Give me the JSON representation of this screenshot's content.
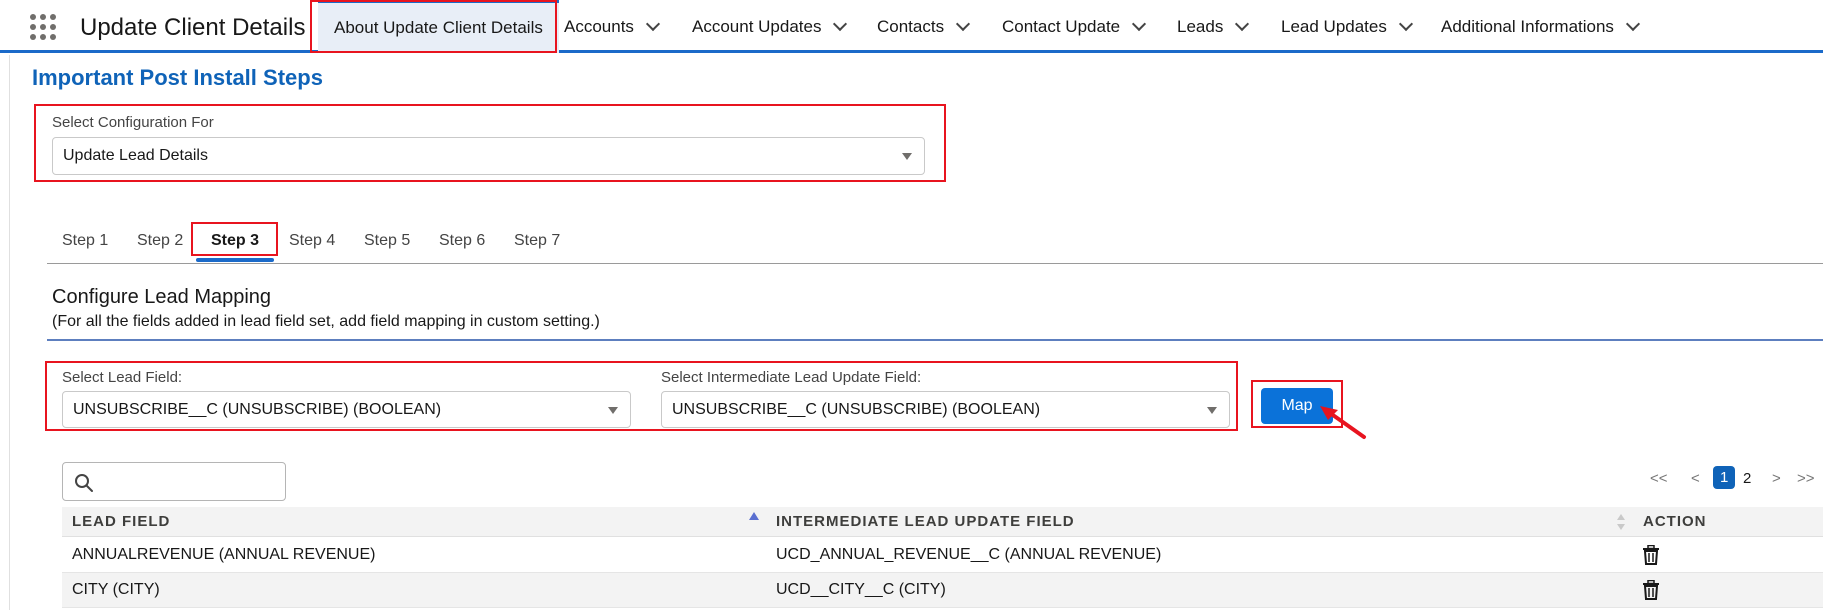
{
  "app": {
    "title": "Update Client Details"
  },
  "nav": {
    "items": [
      {
        "label": "About Update Client Details"
      },
      {
        "label": "Accounts"
      },
      {
        "label": "Account Updates"
      },
      {
        "label": "Contacts"
      },
      {
        "label": "Contact Update"
      },
      {
        "label": "Leads"
      },
      {
        "label": "Lead Updates"
      },
      {
        "label": "Additional Informations"
      }
    ]
  },
  "page": {
    "heading": "Important Post Install Steps"
  },
  "config": {
    "label": "Select Configuration For",
    "value": "Update Lead Details"
  },
  "tabs": [
    {
      "label": "Step 1"
    },
    {
      "label": "Step 2"
    },
    {
      "label": "Step 3"
    },
    {
      "label": "Step 4"
    },
    {
      "label": "Step 5"
    },
    {
      "label": "Step 6"
    },
    {
      "label": "Step 7"
    }
  ],
  "section": {
    "title": "Configure Lead Mapping",
    "subtitle": "(For all the fields added in lead field set, add field mapping in custom setting.)"
  },
  "mapping": {
    "lead_label": "Select Lead Field:",
    "lead_value": "UNSUBSCRIBE__C (UNSUBSCRIBE) (BOOLEAN)",
    "intermediate_label": "Select Intermediate Lead Update Field:",
    "intermediate_value": "UNSUBSCRIBE__C (UNSUBSCRIBE) (BOOLEAN)",
    "map_button": "Map"
  },
  "pager": {
    "first": "<<",
    "prev": "<",
    "page1": "1",
    "page2": "2",
    "next": ">",
    "last": ">>"
  },
  "table": {
    "headers": {
      "lead": "LEAD FIELD",
      "intermediate": "INTERMEDIATE LEAD UPDATE FIELD",
      "action": "ACTION"
    },
    "rows": [
      {
        "lead": "ANNUALREVENUE (ANNUAL REVENUE)",
        "intermediate": "UCD_ANNUAL_REVENUE__C (ANNUAL REVENUE)"
      },
      {
        "lead": "CITY (CITY)",
        "intermediate": "UCD__CITY__C (CITY)"
      }
    ]
  },
  "colors": {
    "brand": "#0f63b8",
    "accent": "#0b72d9",
    "highlight": "#e8141f"
  },
  "icons": [
    "app-launcher-icon",
    "chevron-down-icon",
    "dropdown-triangle-icon",
    "search-icon",
    "sort-asc-icon",
    "sort-icon",
    "trash-icon",
    "arrow-pointer-icon"
  ]
}
